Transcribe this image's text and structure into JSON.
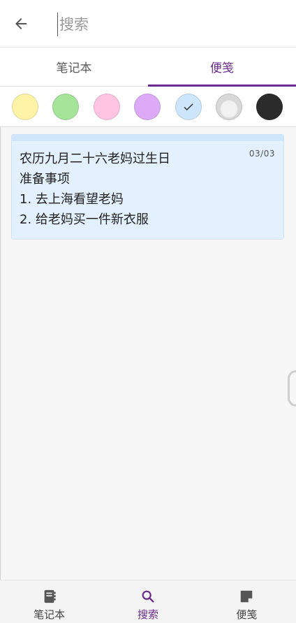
{
  "search": {
    "placeholder": "搜索",
    "value": ""
  },
  "tabs": [
    {
      "label": "笔记本",
      "active": false
    },
    {
      "label": "便笺",
      "active": true
    }
  ],
  "colors": [
    {
      "name": "yellow",
      "hex": "#fff3a8",
      "selected": false
    },
    {
      "name": "green",
      "hex": "#a6e49a",
      "selected": false
    },
    {
      "name": "pink",
      "hex": "#ffc4e2",
      "selected": false
    },
    {
      "name": "purple",
      "hex": "#dcaaf7",
      "selected": false
    },
    {
      "name": "blue",
      "hex": "#cde6fb",
      "selected": true
    },
    {
      "name": "gray",
      "hex": "#d8d8d8",
      "selected": false
    },
    {
      "name": "black",
      "hex": "#2b2b2b",
      "selected": false
    }
  ],
  "note": {
    "date": "03/03",
    "lines": [
      "农历九月二十六老妈过生日",
      "准备事项",
      "1. 去上海看望老妈",
      "2. 给老妈买一件新衣服"
    ]
  },
  "bottom_nav": [
    {
      "label": "笔记本",
      "icon": "notebook-icon",
      "active": false
    },
    {
      "label": "搜索",
      "icon": "search-icon",
      "active": true
    },
    {
      "label": "便笺",
      "icon": "sticky-note-icon",
      "active": false
    }
  ],
  "theme": {
    "accent": "#6a2c8c"
  }
}
